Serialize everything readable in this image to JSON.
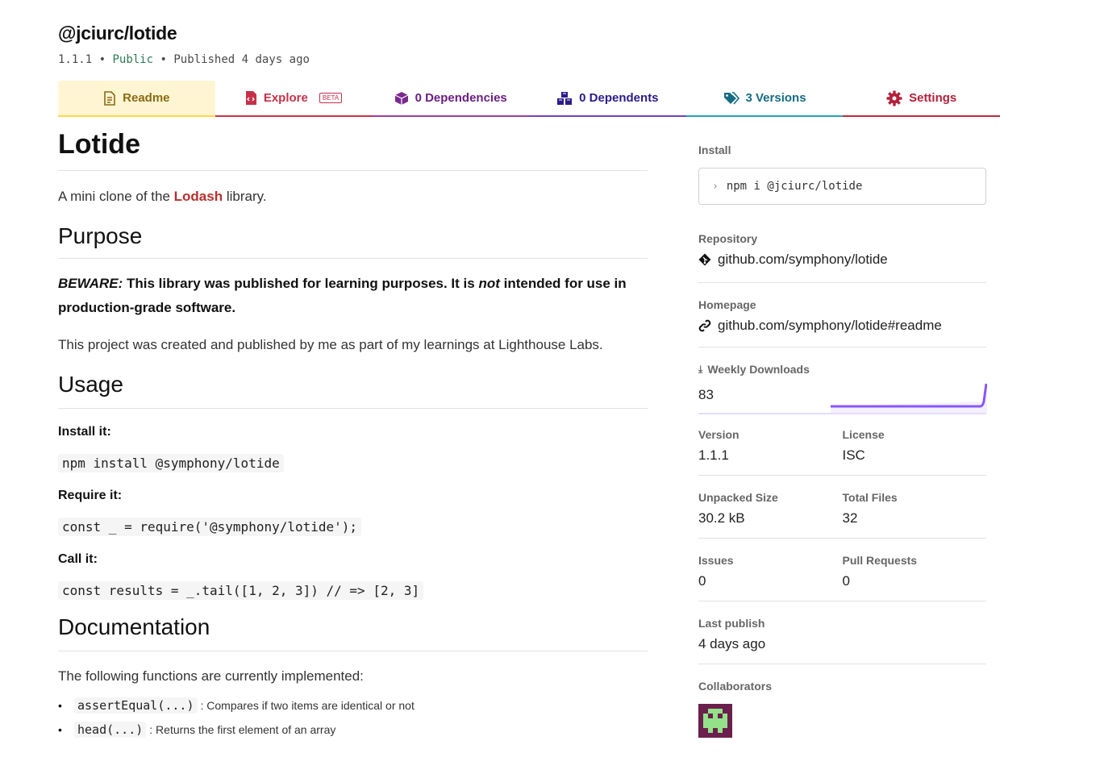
{
  "package": {
    "name": "@jciurc/lotide",
    "version": "1.1.1",
    "visibility": "Public",
    "published": "Published 4 days ago",
    "sep": "•"
  },
  "tabs": [
    {
      "label": "Readme",
      "icon": "file-icon"
    },
    {
      "label": "Explore",
      "badge": "BETA",
      "icon": "file-code-icon"
    },
    {
      "label": "0 Dependencies",
      "icon": "box-icon"
    },
    {
      "label": "0 Dependents",
      "icon": "boxes-icon"
    },
    {
      "label": "3 Versions",
      "icon": "tags-icon"
    },
    {
      "label": "Settings",
      "icon": "gear-icon"
    }
  ],
  "readme": {
    "title": "Lotide",
    "intro_before": "A mini clone of the ",
    "intro_link": "Lodash",
    "intro_after": " library.",
    "purpose_heading": "Purpose",
    "beware_em": "BEWARE:",
    "beware_text": " This library was published for learning purposes. It is ",
    "beware_not": "not",
    "beware_rest": " intended for use in production-grade software.",
    "project_note": "This project was created and published by me as part of my learnings at Lighthouse Labs.",
    "usage_heading": "Usage",
    "install_label": "Install it:",
    "install_code": "npm install @symphony/lotide",
    "require_label": "Require it:",
    "require_code": "const _ = require('@symphony/lotide');",
    "call_label": "Call it:",
    "call_code": "const results = _.tail([1, 2, 3]) // => [2, 3]",
    "docs_heading": "Documentation",
    "docs_intro": "The following functions are currently implemented:",
    "functions": [
      {
        "code": "assertEqual(...)",
        "desc": ": Compares if two items are identical or not"
      },
      {
        "code": "head(...)",
        "desc": ": Returns the first element of an array"
      }
    ]
  },
  "sidebar": {
    "install_label": "Install",
    "install_cmd": "npm i @jciurc/lotide",
    "repository_label": "Repository",
    "repository_value": "github.com/symphony/lotide",
    "homepage_label": "Homepage",
    "homepage_value": "github.com/symphony/lotide#readme",
    "downloads_label": "Weekly Downloads",
    "downloads_value": "83",
    "version_label": "Version",
    "version_value": "1.1.1",
    "license_label": "License",
    "license_value": "ISC",
    "unpacked_label": "Unpacked Size",
    "unpacked_value": "30.2 kB",
    "files_label": "Total Files",
    "files_value": "32",
    "issues_label": "Issues",
    "issues_value": "0",
    "prs_label": "Pull Requests",
    "prs_value": "0",
    "lastpub_label": "Last publish",
    "lastpub_value": "4 days ago",
    "collab_label": "Collaborators"
  },
  "colors": {
    "readme_tab_bg": "#fff5d3",
    "sparkline": "#8956ff",
    "lodash_link": "#b83030",
    "public": "#2d7a55"
  }
}
